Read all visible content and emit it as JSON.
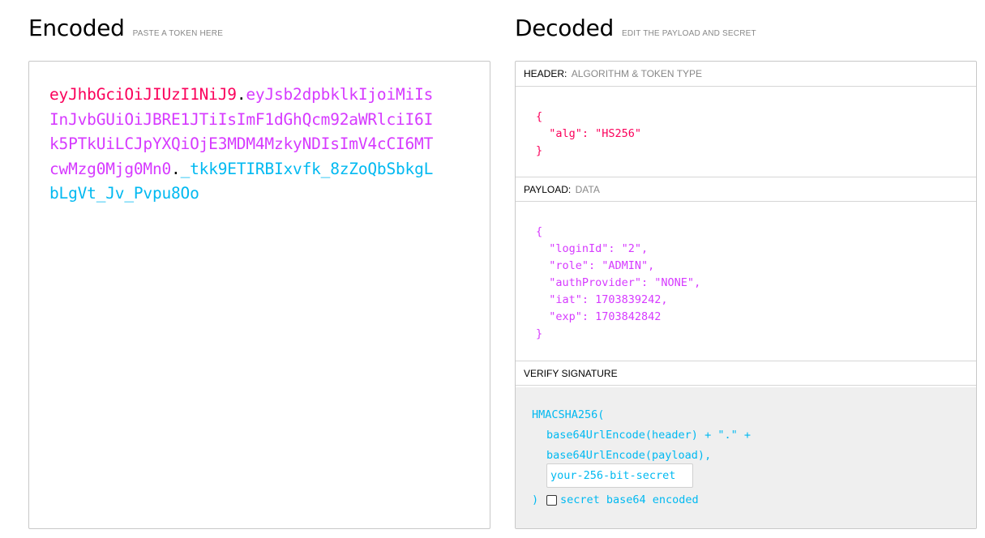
{
  "encoded": {
    "title": "Encoded",
    "hint": "PASTE A TOKEN HERE",
    "token_header": "eyJhbGciOiJIUzI1NiJ9",
    "token_dot1": ".",
    "token_payload": "eyJsb2dpbklkIjoiMiIsInJvbGUiOiJBRE1JTiIsImF1dGhQcm92aWRlciI6Ik5PTkUiLCJpYXQiOjE3MDM4MzkyNDIsImV4cCI6MTcwMzg0Mjg0Mn0",
    "token_dot2": ".",
    "token_signature": "_tkk9ETIRBIxvfk_8zZoQbSbkgLbLgVt_Jv_Pvpu8Oo"
  },
  "decoded": {
    "title": "Decoded",
    "hint": "EDIT THE PAYLOAD AND SECRET",
    "header_section": {
      "label": "HEADER:",
      "sublabel": "ALGORITHM & TOKEN TYPE"
    },
    "header_json": "{\n  \"alg\": \"HS256\"\n}",
    "payload_section": {
      "label": "PAYLOAD:",
      "sublabel": "DATA"
    },
    "payload_json": "{\n  \"loginId\": \"2\",\n  \"role\": \"ADMIN\",\n  \"authProvider\": \"NONE\",\n  \"iat\": 1703839242,\n  \"exp\": 1703842842\n}",
    "verify_section": {
      "label": "VERIFY SIGNATURE"
    },
    "signature": {
      "line1": "HMACSHA256(",
      "line2": "base64UrlEncode(header) + \".\" +",
      "line3": "base64UrlEncode(payload),",
      "secret_placeholder": "your-256-bit-secret",
      "close_paren": ")",
      "checkbox_label": "secret base64 encoded",
      "checkbox_checked": false
    }
  },
  "colors": {
    "header": "#fb015b",
    "payload": "#d63aff",
    "signature": "#00b9f1"
  }
}
